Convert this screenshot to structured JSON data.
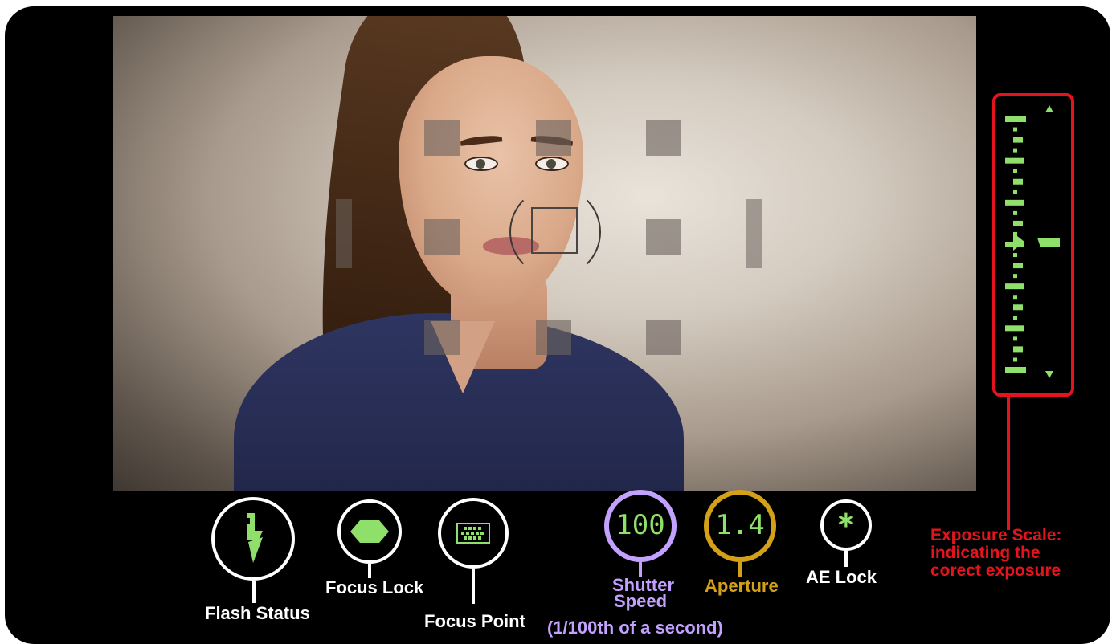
{
  "labels": {
    "flash_status": "Flash Status",
    "focus_lock": "Focus Lock",
    "focus_point": "Focus Point",
    "shutter_speed": "Shutter Speed",
    "shutter_note": "(1/100th of a second)",
    "aperture": "Aperture",
    "ae_lock": "AE Lock",
    "exposure_scale": "Exposure Scale: indicating the corect exposure"
  },
  "readouts": {
    "shutter_value": "100",
    "aperture_value": "1.4",
    "ae_symbol": "*"
  },
  "colors": {
    "lcd_green": "#8ee06a",
    "shutter_ring": "#c3a2ff",
    "aperture_ring": "#d4a017",
    "exposure_red": "#e5141c",
    "label_white": "#ffffff"
  },
  "icons": {
    "flash": "lightning-bolt-icon",
    "focus_lock": "hexagon-icon",
    "focus_point": "af-grid-icon",
    "ae_lock": "asterisk-icon",
    "exposure_up": "triangle-up-icon",
    "exposure_down": "triangle-down-icon",
    "exposure_pointer": "triangle-right-icon"
  },
  "exposure_scale": {
    "level": 0
  }
}
